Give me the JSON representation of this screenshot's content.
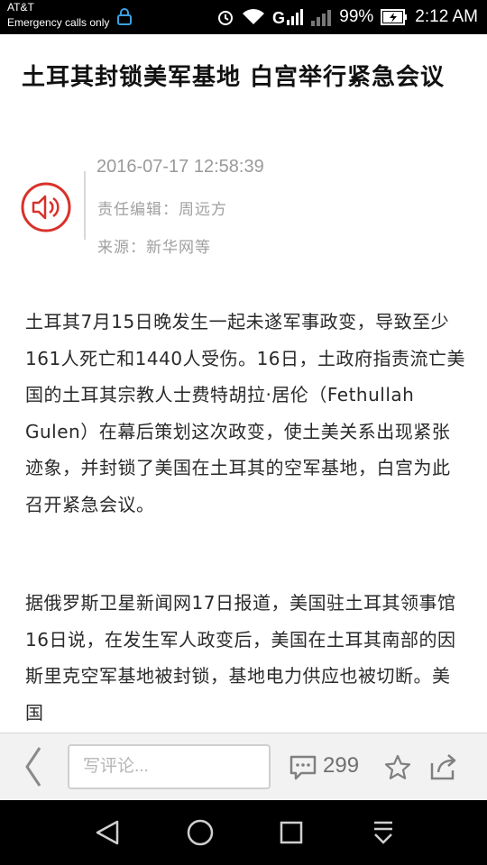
{
  "status_bar": {
    "carrier": "AT&T",
    "emergency": "Emergency calls only",
    "battery_percent": "99%",
    "time": "2:12 AM"
  },
  "article": {
    "title": "土耳其封锁美军基地 白宫举行紧急会议",
    "date": "2016-07-17 12:58:39",
    "editor": "责任编辑：周远方",
    "source": "来源：新华网等",
    "paragraphs": [
      "土耳其7月15日晚发生一起未遂军事政变，导致至少161人死亡和1440人受伤。16日，土政府指责流亡美国的土耳其宗教人士费特胡拉·居伦（Fethullah Gulen）在幕后策划这次政变，使土美关系出现紧张迹象，并封锁了美国在土耳其的空军基地，白宫为此召开紧急会议。",
      "据俄罗斯卫星新闻网17日报道，美国驻土耳其领事馆16日说，在发生军人政变后，美国在土耳其南部的因斯里克空军基地被封锁，基地电力供应也被切断。美国"
    ]
  },
  "bottom_bar": {
    "comment_placeholder": "写评论...",
    "comment_count": "299"
  },
  "colors": {
    "speaker_red": "#d9312b",
    "meta_gray": "#9a9a9a",
    "icon_gray": "#808080"
  }
}
